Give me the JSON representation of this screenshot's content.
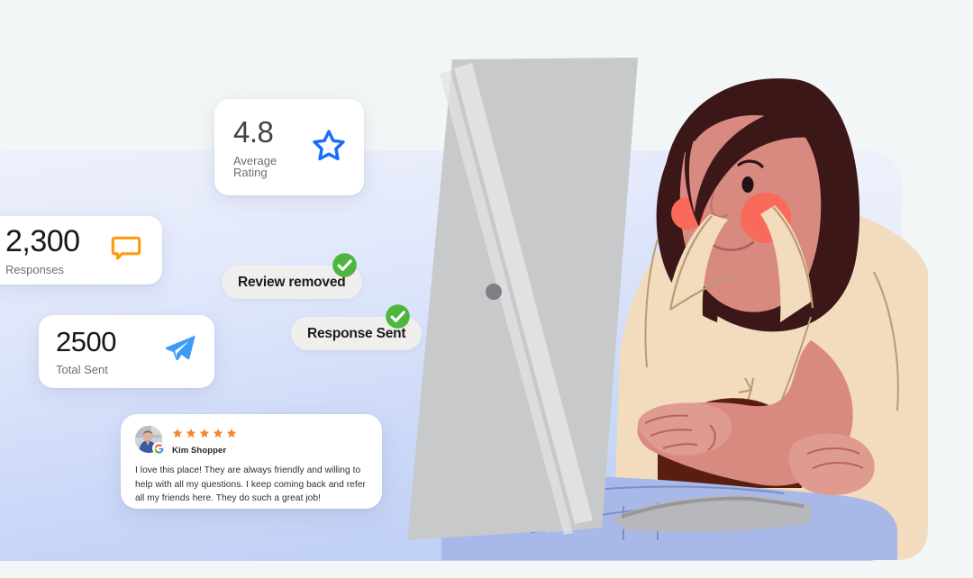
{
  "theme": {
    "page_bg": "#f2f6f6",
    "panel_gradient_from": "#eef1fb",
    "panel_gradient_to": "#b8caf4",
    "accent_blue": "#1a6bff",
    "accent_blue_light": "#3d9bf5",
    "accent_orange": "#ff9a0f",
    "star_orange": "#f5862b",
    "success_green": "#4cb63f",
    "card_white": "#ffffff",
    "toast_gray": "#f0efee"
  },
  "stats": [
    {
      "id": "average-rating",
      "value": "4.8",
      "label": "Average Rating",
      "icon": "star-outline-icon",
      "icon_color": "#1a6bff"
    },
    {
      "id": "responses",
      "value": "2,300",
      "label": "Responses",
      "icon": "chat-bubble-icon",
      "icon_color": "#ff9a0f"
    },
    {
      "id": "total-sent",
      "value": "2500",
      "label": "Total Sent",
      "icon": "paper-plane-icon",
      "icon_color": "#3d9bf5"
    }
  ],
  "toasts": [
    {
      "id": "review-removed",
      "label": "Review removed",
      "icon": "check-circle-icon",
      "icon_color": "#4cb63f"
    },
    {
      "id": "response-sent",
      "label": "Response Sent",
      "icon": "check-circle-icon",
      "icon_color": "#4cb63f"
    }
  ],
  "review": {
    "reviewer_name": "Kim Shopper",
    "rating": 5,
    "rating_stars": "★★★★★",
    "source_icon": "google-g-icon",
    "avatar_icon": "reviewer-avatar-photo",
    "text": "I love this place! They are always friendly and willing to help with all my questions. I keep coming back and refer all my friends here. They do such a great job!"
  },
  "illustration": {
    "name": "woman-at-laptop-illustration",
    "colors": {
      "hair": "#3c1717",
      "skin": "#d98a80",
      "skin_shadow": "#c97a70",
      "blush": "#f96a5a",
      "blazer": "#f2dcbd",
      "blazer_line": "#b99b72",
      "jeans": "#a8b8e8",
      "jeans_line": "#7d8fc4",
      "laptop": "#c8c9cb",
      "laptop_light": "#e0e1e3",
      "laptop_dot": "#7d7f83",
      "hair_back": "#5a1d12"
    }
  }
}
